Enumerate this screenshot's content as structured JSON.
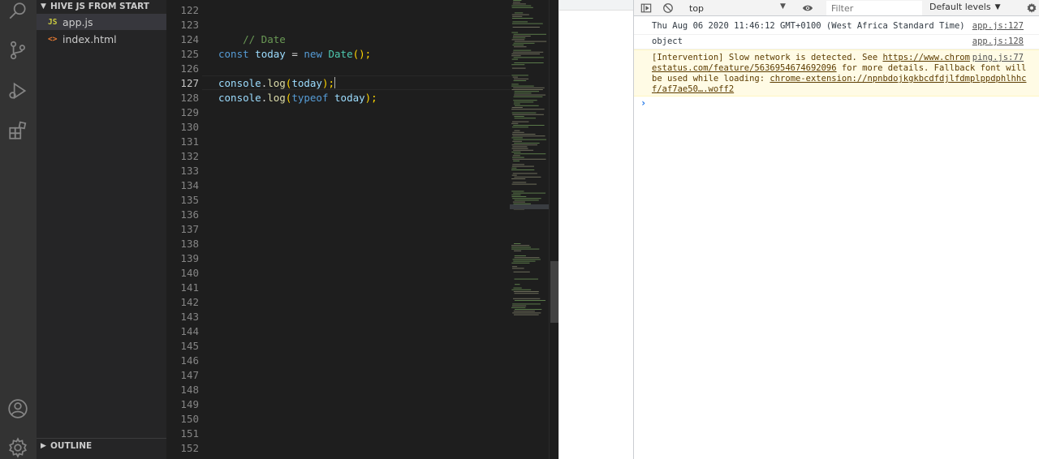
{
  "explorer": {
    "section_title": "HIVE JS FROM START",
    "files": [
      {
        "icon": "JS",
        "name": "app.js",
        "active": true
      },
      {
        "icon": "<>",
        "name": "index.html",
        "active": false
      }
    ],
    "outline_title": "OUTLINE"
  },
  "editor": {
    "line_numbers": [
      "122",
      "123",
      "124",
      "125",
      "126",
      "127",
      "128",
      "129",
      "130",
      "131",
      "132",
      "133",
      "134",
      "135",
      "136",
      "137",
      "138",
      "139",
      "140",
      "141",
      "142",
      "143",
      "144",
      "145",
      "146",
      "147",
      "148",
      "149",
      "150",
      "151",
      "152"
    ],
    "code": {
      "comment": "// Date",
      "line125": {
        "kw": "const",
        "var": "today",
        "eq": " = ",
        "new": "new",
        "cls": "Date",
        "end": "();"
      },
      "line127": {
        "obj": "console",
        "dot": ".",
        "fn": "log",
        "arg": "today",
        "end": ");"
      },
      "line128": {
        "obj": "console",
        "dot": ".",
        "fn": "log",
        "kw": "typeof",
        "arg": "today",
        "end": ");"
      }
    }
  },
  "devtools": {
    "context": "top",
    "filter_placeholder": "Filter",
    "levels": "Default levels",
    "messages": [
      {
        "text": "Thu Aug 06 2020 11:46:12 GMT+0100 (West Africa Standard Time)",
        "source": "app.js:127"
      },
      {
        "text": "object",
        "source": "app.js:128"
      },
      {
        "warn_pre": "[Intervention] Slow network is detected. See ",
        "link1a": "https://www.chrom",
        "link1b": "estatus.com/feature/5636954674692096",
        "warn_mid": " for more details. Fallback font will",
        "warn_line3": "be used while loading: ",
        "link2a": "chrome-extension://npnbdojkgkbcdfdjlfdmplppdphlhhc",
        "link2b": "f/af7ae50….woff2",
        "source": "ping.js:77"
      }
    ],
    "prompt_symbol": "›"
  },
  "colors": {
    "activity_bar": "#333333",
    "sidebar": "#252526",
    "editor_bg": "#1e1e1e",
    "warn_bg": "#fffbe5"
  }
}
